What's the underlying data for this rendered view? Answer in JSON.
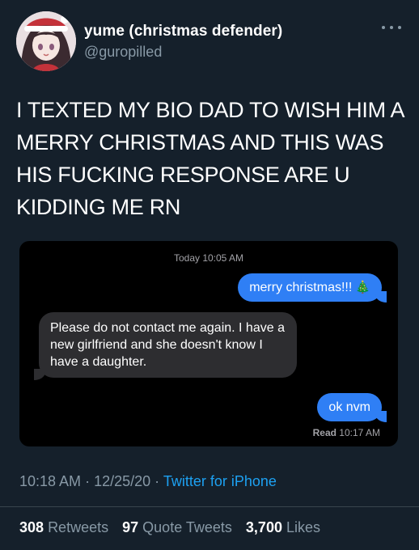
{
  "tweet": {
    "display_name": "yume (christmas defender)",
    "handle": "@guropilled",
    "text": "I TEXTED MY BIO DAD TO WISH HIM A MERRY CHRISTMAS AND THIS WAS HIS FUCKING RESPONSE ARE U KIDDING ME RN",
    "more_icon": "ellipsis-icon"
  },
  "screenshot": {
    "timestamp": "Today 10:05 AM",
    "messages": [
      {
        "side": "sent",
        "text": "merry christmas!!!",
        "emoji": "🎄"
      },
      {
        "side": "received",
        "text": "Please do not contact me again. I have a new girlfriend and she doesn't know I have a daughter."
      },
      {
        "side": "sent",
        "text": "ok nvm"
      }
    ],
    "read_label": "Read",
    "read_time": "10:17 AM"
  },
  "meta": {
    "time": "10:18 AM",
    "separator": " · ",
    "date": "12/25/20",
    "source": "Twitter for iPhone"
  },
  "stats": {
    "retweets_count": "308",
    "retweets_label": "Retweets",
    "quotes_count": "97",
    "quotes_label": "Quote Tweets",
    "likes_count": "3,700",
    "likes_label": "Likes"
  },
  "colors": {
    "background": "#15202b",
    "secondary_text": "#8899a6",
    "link": "#1da1f2",
    "imessage_blue": "#2f7ff5",
    "imessage_gray": "#2d2d30"
  }
}
